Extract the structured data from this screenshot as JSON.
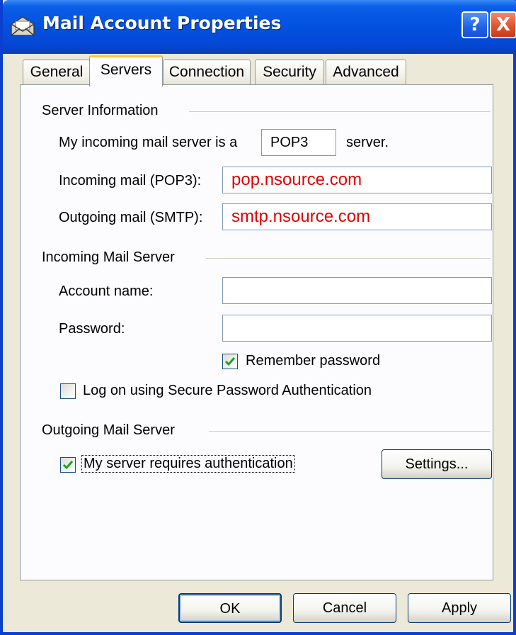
{
  "window": {
    "title": "Mail Account Properties",
    "help_glyph": "?",
    "close_glyph": "X",
    "title_icon": "mail-account-icon"
  },
  "tabs": [
    {
      "label": "General",
      "active": false
    },
    {
      "label": "Servers",
      "active": true
    },
    {
      "label": "Connection",
      "active": false
    },
    {
      "label": "Security",
      "active": false
    },
    {
      "label": "Advanced",
      "active": false
    }
  ],
  "server_info": {
    "heading": "Server Information",
    "incoming_type_label": "My incoming mail server is a",
    "incoming_type_value": "POP3",
    "incoming_type_suffix": "server.",
    "incoming_label": "Incoming mail (POP3):",
    "incoming_value": "pop.nsource.com",
    "outgoing_label": "Outgoing mail (SMTP):",
    "outgoing_value": "smtp.nsource.com"
  },
  "incoming_server": {
    "heading": "Incoming Mail Server",
    "account_label": "Account name:",
    "account_value": "",
    "password_label": "Password:",
    "password_value": "",
    "remember_label": "Remember password",
    "remember_checked": true,
    "spa_label": "Log on using Secure Password Authentication",
    "spa_checked": false
  },
  "outgoing_server": {
    "heading": "Outgoing Mail Server",
    "auth_label": "My server requires authentication",
    "auth_checked": true,
    "settings_label": "Settings..."
  },
  "buttons": {
    "ok": "OK",
    "cancel": "Cancel",
    "apply": "Apply"
  },
  "colors": {
    "titlebar": "#0452e0",
    "server_value_text": "#e10000",
    "checkmark": "#21a121",
    "active_tab_accent": "#ffc83c"
  }
}
